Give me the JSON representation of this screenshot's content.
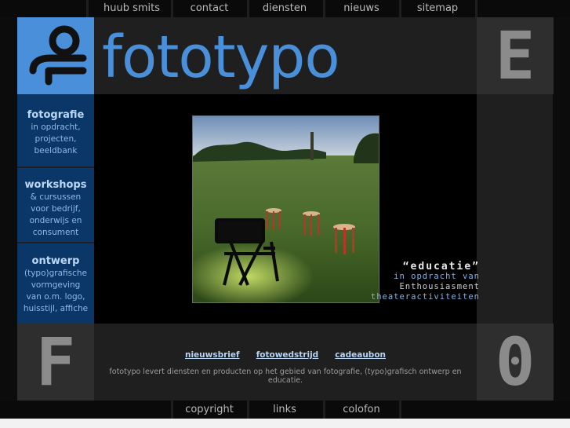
{
  "top_nav": {
    "items": [
      {
        "label": "huub smits"
      },
      {
        "label": "contact"
      },
      {
        "label": "diensten"
      },
      {
        "label": "nieuws"
      },
      {
        "label": "sitemap"
      }
    ]
  },
  "brand": {
    "name": "fototypo",
    "color": "#4a8fd9"
  },
  "sidebar": {
    "background": "#0b3768",
    "sections": [
      {
        "title": "fotografie",
        "lines": [
          "in opdracht,",
          "projecten,",
          "beeldbank"
        ]
      },
      {
        "title": "workshops",
        "lines": [
          "& cursussen",
          "voor bedrijf,",
          "onderwijs en",
          "consument"
        ]
      },
      {
        "title": "ontwerp",
        "lines": [
          "(typo)grafische",
          "vormgeving",
          "van o.m. logo,",
          "huisstijl, affiche"
        ]
      }
    ]
  },
  "tiles": {
    "top_right_letter": "E",
    "bottom_left_letter": "F",
    "bottom_right_letter": "0"
  },
  "photo_caption": {
    "title": "“educatie”",
    "line1": "in opdracht van",
    "line2": "Enthousiasment",
    "line3": "theateractiviteiten"
  },
  "footer": {
    "links": [
      "nieuwsbrief",
      "fotowedstrijd",
      "cadeaubon"
    ],
    "tagline": "fototypo levert diensten en producten op het gebied van fotografie, (typo)grafisch ontwerp en educatie."
  },
  "bottom_nav": {
    "items": [
      {
        "label": "copyright"
      },
      {
        "label": "links"
      },
      {
        "label": "colofon"
      }
    ]
  }
}
